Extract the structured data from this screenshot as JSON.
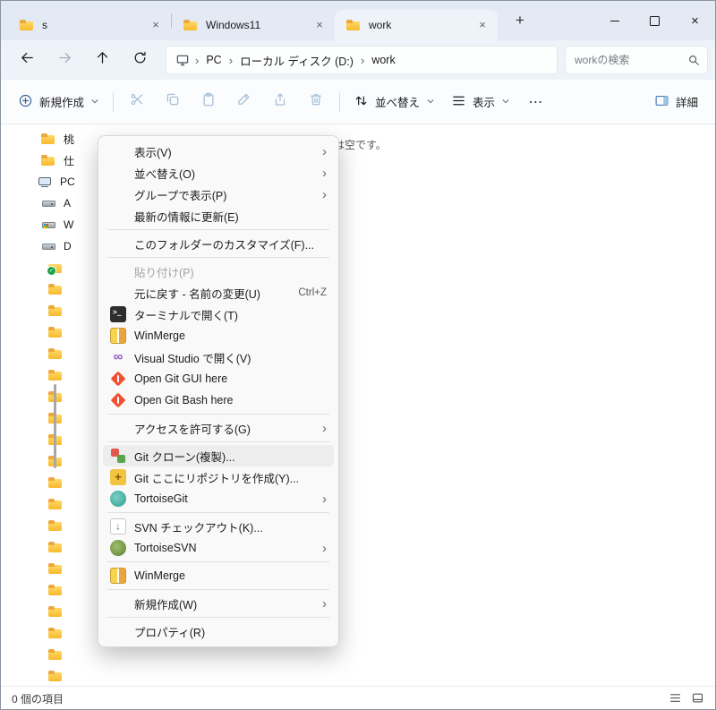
{
  "colors": {
    "titlebar_bg": "#e3eaf4",
    "active_tab_bg": "#eef3fa",
    "toolbar_bg": "#fafcfe",
    "menu_bg": "#f9f9f9",
    "menu_highlight": "#ededed",
    "folder_yellow": "#f7b92e",
    "git_orange": "#f05133",
    "disabled_text": "#a3a3a3"
  },
  "icons": {
    "tab": "folder-icon",
    "nav": [
      "back-icon",
      "forward-icon",
      "up-icon",
      "refresh-icon",
      "this-pc-icon",
      "search-icon"
    ],
    "toolbar": [
      "plus-circle-icon",
      "cut-icon",
      "copy-icon",
      "paste-icon",
      "rename-icon",
      "share-icon",
      "delete-icon",
      "sort-icon",
      "view-icon",
      "more-icon",
      "details-pane-icon"
    ]
  },
  "window": {
    "tabs": [
      {
        "label": "s",
        "active": false
      },
      {
        "label": "Windows11",
        "active": false
      },
      {
        "label": "work",
        "active": true
      }
    ]
  },
  "navbar": {
    "breadcrumb": {
      "items": [
        "PC",
        "ローカル ディスク (D:)",
        "work"
      ]
    },
    "search": {
      "placeholder": "workの検索"
    }
  },
  "toolbar": {
    "new_button": "新規作成",
    "sort_button": "並べ替え",
    "view_button": "表示",
    "details_button": "詳細"
  },
  "sidebar": {
    "items": [
      {
        "icon": "folder",
        "label": "桃",
        "indent": 1
      },
      {
        "icon": "folder",
        "label": "仕",
        "indent": 1
      },
      {
        "icon": "pc",
        "label": "PC",
        "indent": 0
      },
      {
        "icon": "drive",
        "label": "A",
        "indent": 1
      },
      {
        "icon": "drive-win",
        "label": "W",
        "indent": 1
      },
      {
        "icon": "drive",
        "label": "D",
        "indent": 1
      },
      {
        "icon": "folder-sync",
        "label": "",
        "indent": 2
      },
      {
        "icon": "folder",
        "label": "",
        "indent": 2
      },
      {
        "icon": "folder",
        "label": "",
        "indent": 2
      },
      {
        "icon": "folder",
        "label": "",
        "indent": 2
      },
      {
        "icon": "folder",
        "label": "",
        "indent": 2
      },
      {
        "icon": "folder",
        "label": "",
        "indent": 2
      },
      {
        "icon": "folder",
        "label": "",
        "indent": 2
      },
      {
        "icon": "folder",
        "label": "",
        "indent": 2
      },
      {
        "icon": "folder",
        "label": "",
        "indent": 2
      },
      {
        "icon": "folder",
        "label": "",
        "indent": 2
      },
      {
        "icon": "folder",
        "label": "",
        "indent": 2
      },
      {
        "icon": "folder",
        "label": "",
        "indent": 2
      },
      {
        "icon": "folder",
        "label": "",
        "indent": 2
      },
      {
        "icon": "folder",
        "label": "",
        "indent": 2
      },
      {
        "icon": "folder",
        "label": "",
        "indent": 2
      },
      {
        "icon": "folder",
        "label": "",
        "indent": 2
      },
      {
        "icon": "folder",
        "label": "",
        "indent": 2
      },
      {
        "icon": "folder",
        "label": "",
        "indent": 2
      },
      {
        "icon": "folder",
        "label": "",
        "indent": 2
      },
      {
        "icon": "folder",
        "label": "",
        "indent": 2
      }
    ]
  },
  "main": {
    "empty_message": "このフォルダーは空です。"
  },
  "context_menu": {
    "groups": [
      {
        "items": [
          {
            "label": "表示(V)",
            "submenu": true
          },
          {
            "label": "並べ替え(O)",
            "submenu": true
          },
          {
            "label": "グループで表示(P)",
            "submenu": true
          },
          {
            "label": "最新の情報に更新(E)"
          }
        ]
      },
      {
        "items": [
          {
            "label": "このフォルダーのカスタマイズ(F)..."
          }
        ]
      },
      {
        "items": [
          {
            "label": "貼り付け(P)",
            "disabled": true
          },
          {
            "label": "元に戻す - 名前の変更(U)",
            "shortcut": "Ctrl+Z"
          },
          {
            "label": "ターミナルで開く(T)",
            "icon": "terminal"
          },
          {
            "label": "WinMerge",
            "icon": "winmerge"
          },
          {
            "label": "Visual Studio で開く(V)",
            "icon": "visual-studio"
          },
          {
            "label": "Open Git GUI here",
            "icon": "git-gui"
          },
          {
            "label": "Open Git Bash here",
            "icon": "git-bash"
          }
        ]
      },
      {
        "items": [
          {
            "label": "アクセスを許可する(G)",
            "submenu": true
          }
        ]
      },
      {
        "items": [
          {
            "label": "Git クローン(複製)...",
            "icon": "git-clone",
            "highlighted": true
          },
          {
            "label": "Git ここにリポジトリを作成(Y)...",
            "icon": "git-init"
          },
          {
            "label": "TortoiseGit",
            "icon": "tortoisegit",
            "submenu": true
          }
        ]
      },
      {
        "items": [
          {
            "label": "SVN チェックアウト(K)...",
            "icon": "svn-checkout"
          },
          {
            "label": "TortoiseSVN",
            "icon": "tortoisesvn",
            "submenu": true
          }
        ]
      },
      {
        "items": [
          {
            "label": "WinMerge",
            "icon": "winmerge"
          }
        ]
      },
      {
        "items": [
          {
            "label": "新規作成(W)",
            "submenu": true
          }
        ]
      },
      {
        "items": [
          {
            "label": "プロパティ(R)"
          }
        ]
      }
    ]
  },
  "statusbar": {
    "items_count": "0 個の項目"
  }
}
